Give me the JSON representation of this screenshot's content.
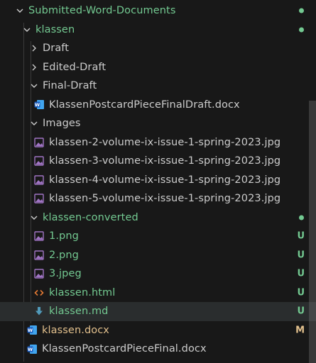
{
  "colors": {
    "background": "#181818",
    "untracked": "#73c991",
    "modified": "#e2c08d",
    "default_text": "#cccccc",
    "selected_row": "#2a2d2e"
  },
  "rows": [
    {
      "label": "Submitted-Word-Documents",
      "type": "folder-open",
      "status": "dot"
    },
    {
      "label": "klassen",
      "type": "folder-open",
      "status": "dot"
    },
    {
      "label": "Draft",
      "type": "folder-closed"
    },
    {
      "label": "Edited-Draft",
      "type": "folder-closed"
    },
    {
      "label": "Final-Draft",
      "type": "folder-open"
    },
    {
      "label": "KlassenPostcardPieceFinalDraft.docx",
      "type": "word-icon"
    },
    {
      "label": "Images",
      "type": "folder-open"
    },
    {
      "label": "klassen-2-volume-ix-issue-1-spring-2023.jpg",
      "type": "image-icon"
    },
    {
      "label": "klassen-3-volume-ix-issue-1-spring-2023.jpg",
      "type": "image-icon"
    },
    {
      "label": "klassen-4-volume-ix-issue-1-spring-2023.jpg",
      "type": "image-icon"
    },
    {
      "label": "klassen-5-volume-ix-issue-1-spring-2023.jpg",
      "type": "image-icon"
    },
    {
      "label": "klassen-converted",
      "type": "folder-open",
      "status": "dot"
    },
    {
      "label": "1.png",
      "type": "image-icon",
      "status": "U"
    },
    {
      "label": "2.png",
      "type": "image-icon",
      "status": "U"
    },
    {
      "label": "3.jpeg",
      "type": "image-icon",
      "status": "U"
    },
    {
      "label": "klassen.html",
      "type": "html-icon",
      "status": "U"
    },
    {
      "label": "klassen.md",
      "type": "markdown-icon",
      "status": "U"
    },
    {
      "label": "klassen.docx",
      "type": "word-icon",
      "status": "M"
    },
    {
      "label": "KlassenPostcardPieceFinal.docx",
      "type": "word-icon"
    }
  ]
}
